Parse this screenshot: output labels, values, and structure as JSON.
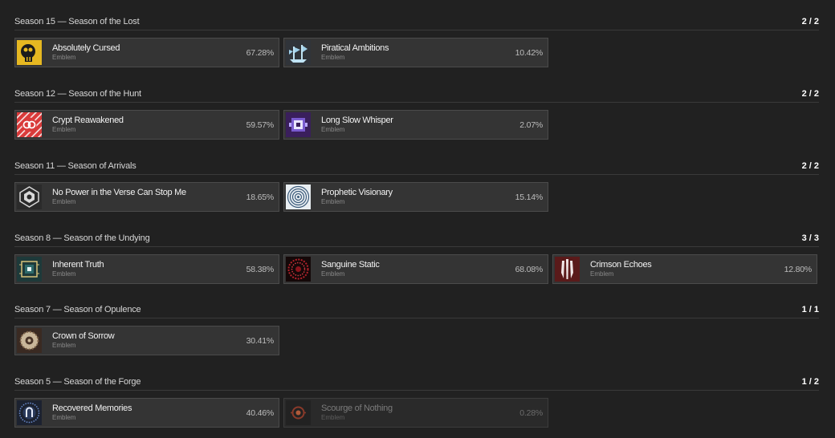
{
  "sections": [
    {
      "title": "Season 15 — Season of the Lost",
      "count": "2 / 2",
      "items": [
        {
          "name": "Absolutely Cursed",
          "type": "Emblem",
          "pct": "67.28%",
          "icon": "skull-emblem-icon"
        },
        {
          "name": "Piratical Ambitions",
          "type": "Emblem",
          "pct": "10.42%",
          "icon": "ship-emblem-icon"
        }
      ]
    },
    {
      "title": "Season 12 — Season of the Hunt",
      "count": "2 / 2",
      "items": [
        {
          "name": "Crypt Reawakened",
          "type": "Emblem",
          "pct": "59.57%",
          "icon": "crypt-emblem-icon"
        },
        {
          "name": "Long Slow Whisper",
          "type": "Emblem",
          "pct": "2.07%",
          "icon": "whisper-emblem-icon"
        }
      ]
    },
    {
      "title": "Season 11 — Season of Arrivals",
      "count": "2 / 2",
      "items": [
        {
          "name": "No Power in the Verse Can Stop Me",
          "type": "Emblem",
          "pct": "18.65%",
          "icon": "shield-emblem-icon"
        },
        {
          "name": "Prophetic Visionary",
          "type": "Emblem",
          "pct": "15.14%",
          "icon": "spiral-emblem-icon"
        }
      ]
    },
    {
      "title": "Season 8 — Season of the Undying",
      "count": "3 / 3",
      "items": [
        {
          "name": "Inherent Truth",
          "type": "Emblem",
          "pct": "58.38%",
          "icon": "circuit-emblem-icon"
        },
        {
          "name": "Sanguine Static",
          "type": "Emblem",
          "pct": "68.08%",
          "icon": "static-emblem-icon"
        },
        {
          "name": "Crimson Echoes",
          "type": "Emblem",
          "pct": "12.80%",
          "icon": "claws-emblem-icon"
        }
      ]
    },
    {
      "title": "Season 7 — Season of Opulence",
      "count": "1 / 1",
      "items": [
        {
          "name": "Crown of Sorrow",
          "type": "Emblem",
          "pct": "30.41%",
          "icon": "crown-emblem-icon"
        }
      ]
    },
    {
      "title": "Season 5 — Season of the Forge",
      "count": "1 / 2",
      "items": [
        {
          "name": "Recovered Memories",
          "type": "Emblem",
          "pct": "40.46%",
          "icon": "memory-emblem-icon"
        },
        {
          "name": "Scourge of Nothing",
          "type": "Emblem",
          "pct": "0.28%",
          "icon": "scourge-emblem-icon",
          "obtained": false
        }
      ]
    }
  ]
}
